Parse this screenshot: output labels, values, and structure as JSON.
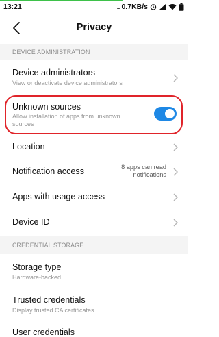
{
  "status": {
    "time": "13:21",
    "net_speed": "0.7KB/s",
    "icons": [
      "alarm-icon",
      "signal-icon",
      "wifi-icon",
      "battery-icon"
    ],
    "progress_color": "#3ec14a"
  },
  "header": {
    "title": "Privacy"
  },
  "sections": {
    "device_admin": "DEVICE ADMINISTRATION",
    "credential_storage": "CREDENTIAL STORAGE"
  },
  "items": {
    "device_administrators": {
      "title": "Device administrators",
      "subtitle": "View or deactivate device administrators"
    },
    "unknown_sources": {
      "title": "Unknown sources",
      "subtitle": "Allow installation of apps from unknown sources",
      "enabled": true
    },
    "location": {
      "title": "Location"
    },
    "notification_access": {
      "title": "Notification access",
      "value_line1": "8 apps can read",
      "value_line2": "notifications"
    },
    "usage_access": {
      "title": "Apps with usage access"
    },
    "device_id": {
      "title": "Device ID"
    },
    "storage_type": {
      "title": "Storage type",
      "subtitle": "Hardware-backed"
    },
    "trusted_credentials": {
      "title": "Trusted credentials",
      "subtitle": "Display trusted CA certificates"
    },
    "user_credentials": {
      "title": "User credentials"
    }
  },
  "colors": {
    "accent": "#1e88e5",
    "highlight": "#e0242a"
  }
}
